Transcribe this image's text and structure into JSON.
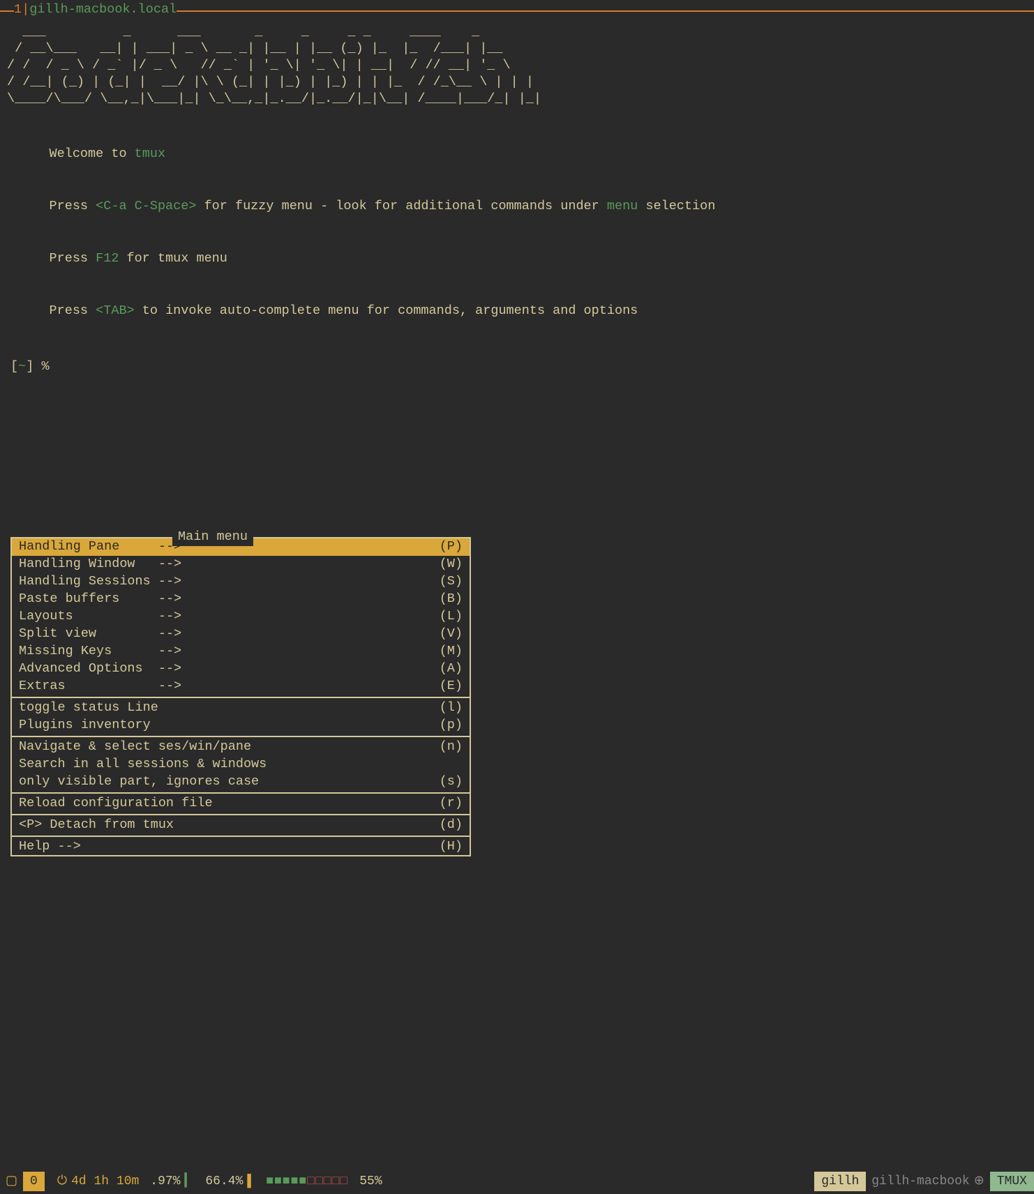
{
  "top": {
    "index": "1",
    "sep": "  |  ",
    "host": "gillh-macbook.local"
  },
  "ascii": "  ___          _      ___       _     _     _ _     ____    _    \n / __\\___   __| | ___| _ \\ __ _| |__ | |__ (_) |_  |_  /___| |__ \n/ /  / _ \\ / _` |/ _ \\   // _` | '_ \\| '_ \\| | __|  / // __| '_ \\ \n/ /__| (_) | (_| |  __/ |\\ \\ (_| | |_) | |_) | | |_  / /_\\__ \\ | | |\n\\____/\\___/ \\__,_|\\___|_| \\_\\__,_|_.__/|_.__/|_|\\__| /____|___/_| |_|",
  "welcome": {
    "line1_a": " Welcome to ",
    "line1_b": "tmux",
    "line2_a": " Press ",
    "line2_b": "<C-a C-Space>",
    "line2_c": " for fuzzy menu - look for additional commands under ",
    "line2_d": "menu",
    "line2_e": " selection",
    "line3_a": " Press ",
    "line3_b": "F12",
    "line3_c": " for tmux menu",
    "line4_a": " Press ",
    "line4_b": "<TAB>",
    "line4_c": " to invoke auto-complete menu for commands, arguments and options"
  },
  "prompt": {
    "lb": "[",
    "tilde": "~",
    "rb": "] ",
    "pct": "%"
  },
  "menu": {
    "title": " Main menu ",
    "items_a": [
      {
        "label": "Handling Pane     ",
        "arrow": "-->",
        "key": "(P)",
        "selected": true
      },
      {
        "label": "Handling Window   ",
        "arrow": "-->",
        "key": "(W)"
      },
      {
        "label": "Handling Sessions ",
        "arrow": "-->",
        "key": "(S)"
      },
      {
        "label": "Paste buffers     ",
        "arrow": "-->",
        "key": "(B)"
      },
      {
        "label": "Layouts           ",
        "arrow": "-->",
        "key": "(L)"
      },
      {
        "label": "Split view        ",
        "arrow": "-->",
        "key": "(V)"
      },
      {
        "label": "Missing Keys      ",
        "arrow": "-->",
        "key": "(M)"
      },
      {
        "label": "Advanced Options  ",
        "arrow": "-->",
        "key": "(A)"
      },
      {
        "label": "Extras            ",
        "arrow": "-->",
        "key": "(E)"
      }
    ],
    "items_b": [
      {
        "label": "toggle status Line",
        "key": "(l)"
      },
      {
        "label": "Plugins inventory",
        "key": "(p)"
      }
    ],
    "items_c": [
      {
        "label": "Navigate & select ses/win/pane",
        "key": "(n)"
      },
      {
        "label": "Search in all sessions & windows",
        "key": ""
      },
      {
        "label": "only visible part, ignores case",
        "key": "(s)"
      }
    ],
    "items_d": [
      {
        "label": "Reload configuration file",
        "key": "(r)"
      }
    ],
    "items_e": [
      {
        "label": "<P> Detach from tmux",
        "key": "(d)"
      }
    ],
    "items_f": [
      {
        "label": "Help -->",
        "key": "(H)"
      }
    ]
  },
  "status": {
    "index_box": "▢",
    "index": "0",
    "power": "⏻",
    "uptime": "4d 1h 10m",
    "pct1": ".97%",
    "bar1": "▎",
    "cpu": "66.4%",
    "bar2": "▌",
    "boxes_filled": "■■■■■",
    "boxes_empty": "□□□□□",
    "pct2": "55%",
    "user": "gillh",
    "host": "gillh-macbook",
    "globe": "⊕",
    "tmux": "TMUX"
  }
}
